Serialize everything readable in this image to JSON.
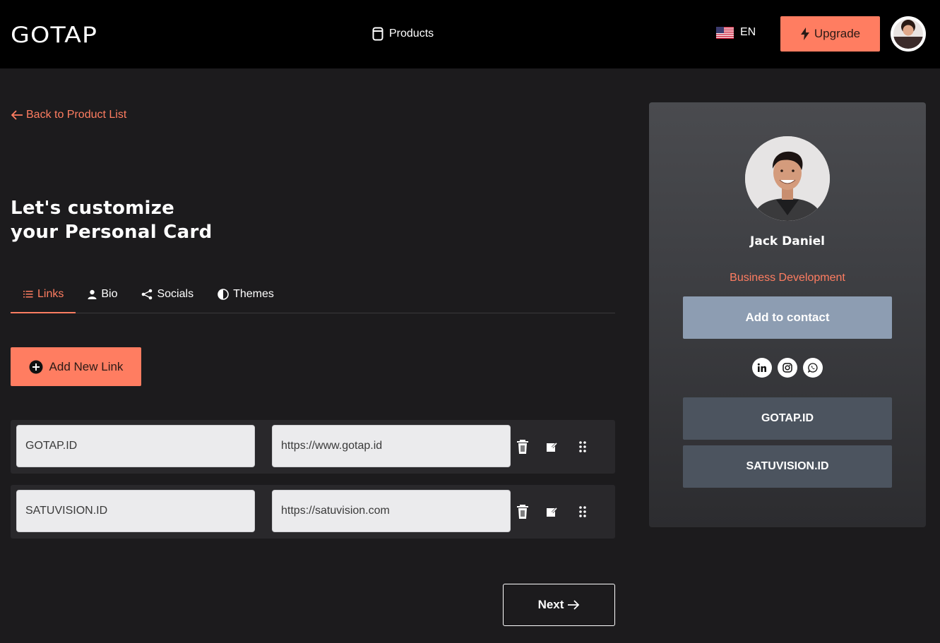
{
  "header": {
    "logo": "GOTAP",
    "nav_products": "Products",
    "language": "EN",
    "upgrade_label": "Upgrade"
  },
  "back_link": "Back to Product List",
  "title": {
    "line1": "Let's customize",
    "line2": "your Personal Card"
  },
  "tabs": [
    {
      "label": "Links",
      "icon": "list-icon",
      "active": true
    },
    {
      "label": "Bio",
      "icon": "user-icon",
      "active": false
    },
    {
      "label": "Socials",
      "icon": "share-icon",
      "active": false
    },
    {
      "label": "Themes",
      "icon": "contrast-icon",
      "active": false
    }
  ],
  "add_link_label": "Add New Link",
  "links": [
    {
      "title": "GOTAP.ID",
      "url": "https://www.gotap.id"
    },
    {
      "title": "SATUVISION.ID",
      "url": "https://satuvision.com"
    }
  ],
  "next_label": "Next",
  "preview": {
    "name": "Jack Daniel",
    "role": "Business Development",
    "add_contact_label": "Add to contact",
    "socials": [
      "linkedin-icon",
      "instagram-icon",
      "whatsapp-icon"
    ],
    "links": [
      "GOTAP.ID",
      "SATUVISION.ID"
    ]
  },
  "colors": {
    "accent": "#ff7d61",
    "background": "#1c1b1d",
    "header": "#000000",
    "contact_button": "#8d9db2",
    "card_link": "#4c545f"
  }
}
